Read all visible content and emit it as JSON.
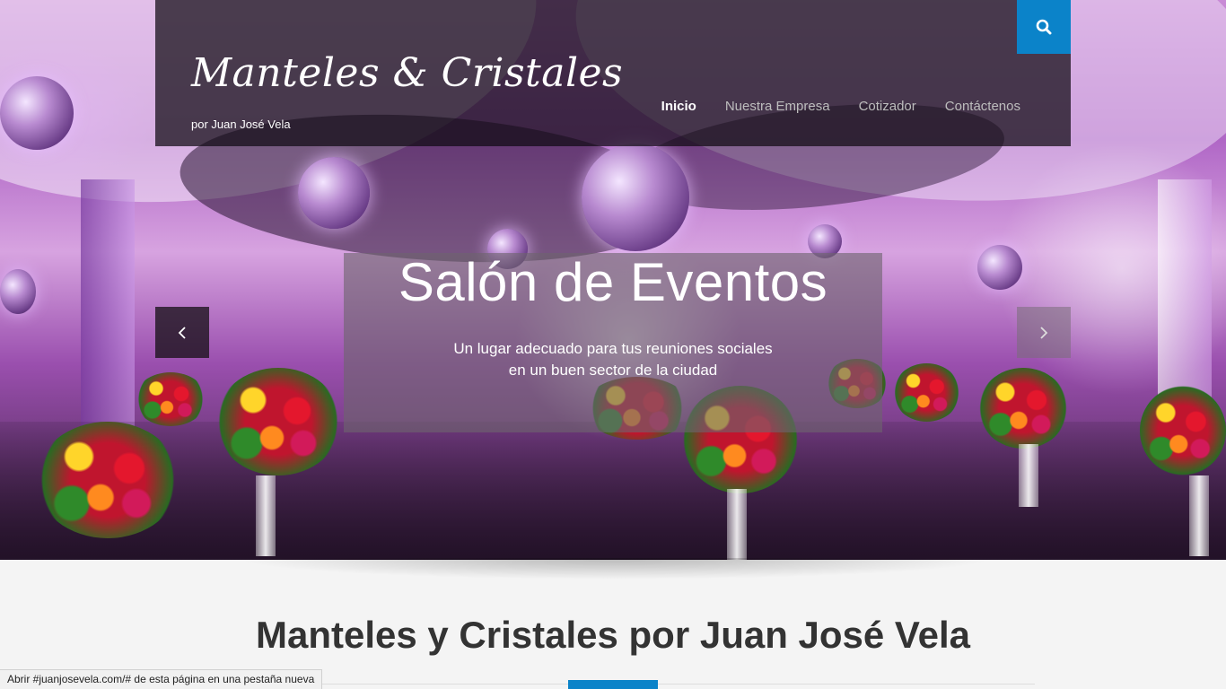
{
  "header": {
    "logo": "Manteles & Cristales",
    "tagline": "por Juan José Vela",
    "nav": [
      {
        "label": "Inicio"
      },
      {
        "label": "Nuestra Empresa"
      },
      {
        "label": "Cotizador"
      },
      {
        "label": "Contáctenos"
      }
    ],
    "search_icon": "search-icon"
  },
  "slider": {
    "title": "Salón de Eventos",
    "subtitle_line1": "Un lugar adecuado para tus reuniones sociales",
    "subtitle_line2": "en un buen sector de la ciudad",
    "prev_icon": "chevron-left-icon",
    "next_icon": "chevron-right-icon"
  },
  "section": {
    "title_bold": "Manteles y Cristales",
    "title_rest": " por Juan José Vela"
  },
  "status_bar": {
    "text": "Abrir #juanjosevela.com/# de esta página en una pestaña nueva"
  },
  "colors": {
    "accent": "#0b83c9"
  }
}
